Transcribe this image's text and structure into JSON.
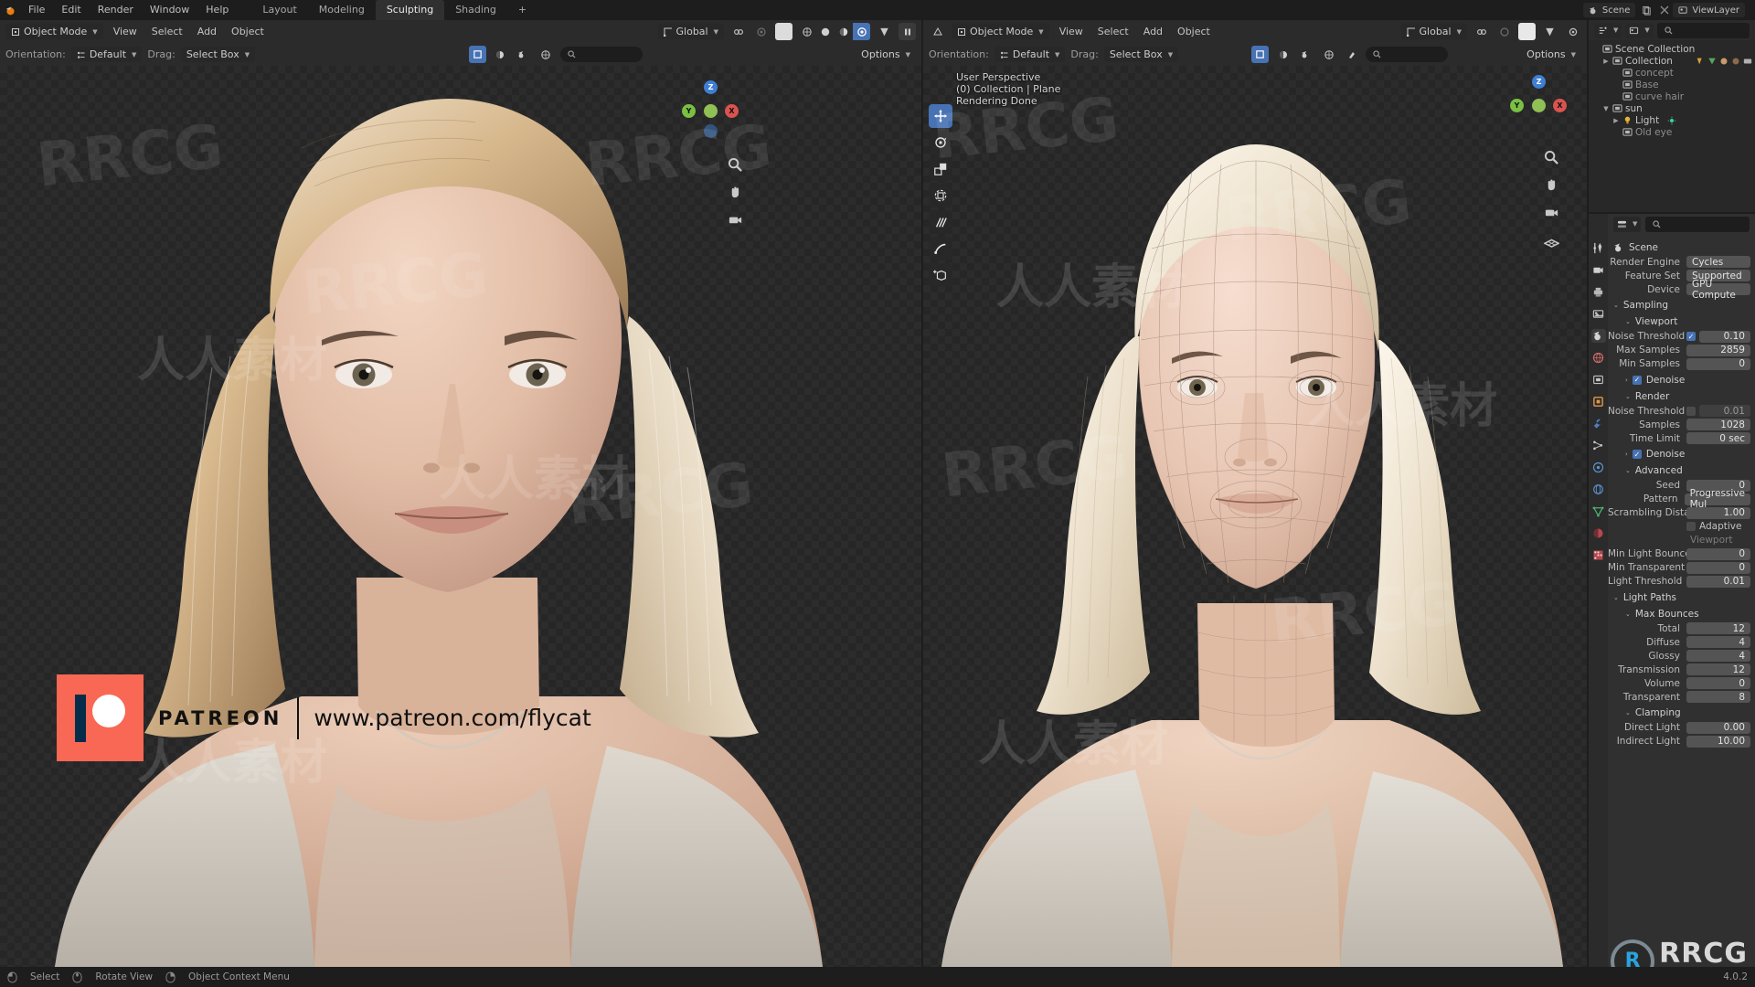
{
  "app": {
    "title": "Blender"
  },
  "topbar": {
    "menus": [
      "File",
      "Edit",
      "Render",
      "Window",
      "Help"
    ],
    "workspaces": [
      {
        "label": "Layout",
        "active": false
      },
      {
        "label": "Modeling",
        "active": false
      },
      {
        "label": "Sculpting",
        "active": true
      },
      {
        "label": "Shading",
        "active": false
      },
      {
        "label": "+",
        "active": false
      }
    ],
    "scene_name": "Scene",
    "viewlayer_name": "ViewLayer"
  },
  "left_viewport": {
    "mode": "Object Mode",
    "menus": [
      "View",
      "Select",
      "Add",
      "Object"
    ],
    "orientation_label": "Orientation:",
    "orientation_value": "Default",
    "drag_label": "Drag:",
    "drag_value": "Select Box",
    "transform_value": "Global",
    "options_label": "Options",
    "shading_modes": [
      "wireframe",
      "solid",
      "material-preview",
      "rendered"
    ],
    "shading_active": "rendered"
  },
  "right_viewport": {
    "mode": "Object Mode",
    "menus": [
      "View",
      "Select",
      "Add",
      "Object"
    ],
    "orientation_label": "Orientation:",
    "orientation_value": "Default",
    "drag_label": "Drag:",
    "drag_value": "Select Box",
    "transform_value": "Global",
    "options_label": "Options",
    "overlay": {
      "line1": "User Perspective",
      "line2": "(0) Collection | Plane",
      "line3": "Rendering Done"
    },
    "tools": [
      {
        "name": "tweak-move",
        "glyph": "✥",
        "active": true
      },
      {
        "name": "rotate",
        "glyph": "⟳",
        "active": false
      },
      {
        "name": "scale",
        "glyph": "⬔",
        "active": false
      },
      {
        "name": "transform",
        "glyph": "⊞",
        "active": false
      },
      {
        "name": "annotate",
        "glyph": "✎",
        "active": false
      },
      {
        "name": "measure",
        "glyph": "📏",
        "active": false
      },
      {
        "name": "add-cube",
        "glyph": "⬚",
        "active": false
      }
    ],
    "gizmo_axes": [
      "Z",
      "Y",
      "X"
    ],
    "nav_icons": [
      "zoom-icon",
      "hand-icon",
      "camera-icon",
      "grid-icon"
    ]
  },
  "outliner": {
    "filter_placeholder": "",
    "rows": [
      {
        "label": "Scene Collection",
        "indent": 0,
        "tri": "",
        "icon": "collection-icon",
        "dim": false
      },
      {
        "label": "Collection",
        "indent": 1,
        "tri": "▶",
        "icon": "collection-icon",
        "dim": false
      },
      {
        "label": "concept",
        "indent": 2,
        "tri": "",
        "icon": "collection-icon",
        "dim": true
      },
      {
        "label": "Base",
        "indent": 2,
        "tri": "",
        "icon": "collection-icon",
        "dim": true
      },
      {
        "label": "curve hair",
        "indent": 2,
        "tri": "",
        "icon": "collection-icon",
        "dim": true
      },
      {
        "label": "sun",
        "indent": 1,
        "tri": "▼",
        "icon": "collection-icon",
        "dim": false
      },
      {
        "label": "Light",
        "indent": 2,
        "tri": "▶",
        "icon": "light-icon",
        "dim": false
      },
      {
        "label": "Old eye",
        "indent": 2,
        "tri": "",
        "icon": "collection-icon",
        "dim": true
      }
    ]
  },
  "properties": {
    "breadcrumb": "Scene",
    "search_placeholder": "",
    "tabs": [
      "tool-icon",
      "render-icon",
      "output-icon",
      "viewlayer-icon",
      "scene-icon",
      "world-icon",
      "collection-icon",
      "object-icon",
      "modifier-icon",
      "particles-icon",
      "physics-icon",
      "constraint-icon",
      "data-icon",
      "material-icon",
      "texture-icon"
    ],
    "active_tab_index": 4,
    "rows": [
      {
        "type": "field",
        "label": "Render Engine",
        "value": "Cycles",
        "style": "left"
      },
      {
        "type": "field",
        "label": "Feature Set",
        "value": "Supported",
        "style": "left"
      },
      {
        "type": "field",
        "label": "Device",
        "value": "GPU Compute",
        "style": "left"
      },
      {
        "type": "section",
        "label": "Sampling",
        "indent": 0,
        "caret": "⌄"
      },
      {
        "type": "section",
        "label": "Viewport",
        "indent": 1,
        "caret": "⌄"
      },
      {
        "type": "check_field",
        "label": "Noise Threshold",
        "value": "0.10",
        "checked": true
      },
      {
        "type": "field",
        "label": "Max Samples",
        "value": "2859"
      },
      {
        "type": "field",
        "label": "Min Samples",
        "value": "0"
      },
      {
        "type": "section_check",
        "label": "Denoise",
        "indent": 1,
        "caret": "›",
        "checked": true
      },
      {
        "type": "section",
        "label": "Render",
        "indent": 1,
        "caret": "⌄"
      },
      {
        "type": "check_field",
        "label": "Noise Threshold",
        "value": "0.01",
        "checked": false,
        "dim": true
      },
      {
        "type": "field",
        "label": "Samples",
        "value": "1028"
      },
      {
        "type": "field",
        "label": "Time Limit",
        "value": "0 sec"
      },
      {
        "type": "section_check",
        "label": "Denoise",
        "indent": 1,
        "caret": "›",
        "checked": true
      },
      {
        "type": "section",
        "label": "Advanced",
        "indent": 1,
        "caret": "⌄"
      },
      {
        "type": "field",
        "label": "Seed",
        "value": "0"
      },
      {
        "type": "field",
        "label": "Pattern",
        "value": "Progressive Mul",
        "style": "left"
      },
      {
        "type": "field",
        "label": "Scrambling Distan...",
        "value": "1.00"
      },
      {
        "type": "toggle",
        "label": "Adaptive",
        "checked": false
      },
      {
        "type": "subtle",
        "label": "Viewport"
      },
      {
        "type": "field",
        "label": "Min Light Bounces",
        "value": "0"
      },
      {
        "type": "field",
        "label": "Min Transparent B...",
        "value": "0"
      },
      {
        "type": "field",
        "label": "Light Threshold",
        "value": "0.01"
      },
      {
        "type": "section",
        "label": "Light Paths",
        "indent": 0,
        "caret": "⌄"
      },
      {
        "type": "section",
        "label": "Max Bounces",
        "indent": 1,
        "caret": "⌄"
      },
      {
        "type": "field",
        "label": "Total",
        "value": "12"
      },
      {
        "type": "field",
        "label": "Diffuse",
        "value": "4"
      },
      {
        "type": "field",
        "label": "Glossy",
        "value": "4"
      },
      {
        "type": "field",
        "label": "Transmission",
        "value": "12"
      },
      {
        "type": "field",
        "label": "Volume",
        "value": "0"
      },
      {
        "type": "field",
        "label": "Transparent",
        "value": "8"
      },
      {
        "type": "section",
        "label": "Clamping",
        "indent": 1,
        "caret": "⌄"
      },
      {
        "type": "field",
        "label": "Direct Light",
        "value": "0.00"
      },
      {
        "type": "field",
        "label": "Indirect Light",
        "value": "10.00"
      }
    ]
  },
  "patreon": {
    "brand": "PATREON",
    "url": "www.patreon.com/flycat",
    "accent": "#f96854"
  },
  "rrcg": {
    "logo_text": "RRCG",
    "cn_text": "人人素材",
    "mark": "R"
  },
  "watermarks": {
    "rrcg": "RRCG",
    "cn": "人人素材"
  },
  "statusbar": {
    "items": [
      "Select",
      "Rotate View",
      "Object Context Menu"
    ],
    "version": "4.0.2"
  }
}
